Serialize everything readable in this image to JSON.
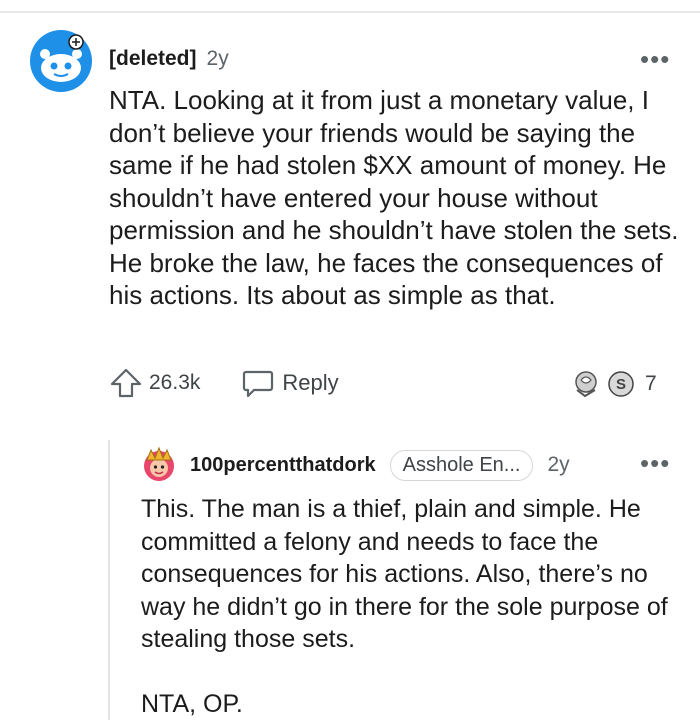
{
  "comment": {
    "author": "[deleted]",
    "age": "2y",
    "body": "NTA. Looking at it from just a monetary value, I don’t believe your friends would be saying the same if he had stolen $XX amount of money. He shouldn’t have entered your house without permission and he shouldn’t have stolen the sets. He broke the law, he faces the consequences of his actions. Its about as simple as that.",
    "score": "26.3k",
    "reply_label": "Reply",
    "award_count": "7",
    "more_label": "•••"
  },
  "reply": {
    "author": "100percentthatdork",
    "flair": "Asshole En...",
    "age": "2y",
    "paragraphs": [
      "This. The man is a thief, plain and simple. He committed a felony and needs to face the consequences for his actions. Also, there’s no way he didn’t go in there for the sole purpose of stealing those sets.",
      "NTA, OP."
    ],
    "more_label": "•••"
  },
  "icons": {
    "avatar_main": "snoo-avatar-icon",
    "avatar_reply": "user-avatar-icon",
    "upvote": "upvote-arrow-icon",
    "reply": "speech-bubble-icon",
    "awards": [
      "award-icon-1",
      "award-icon-2"
    ]
  },
  "colors": {
    "avatar_blue": "#1e90e8",
    "text": "#1c1c1c",
    "muted": "#5d6468",
    "avatar_reply_pink": "#e8466b"
  }
}
